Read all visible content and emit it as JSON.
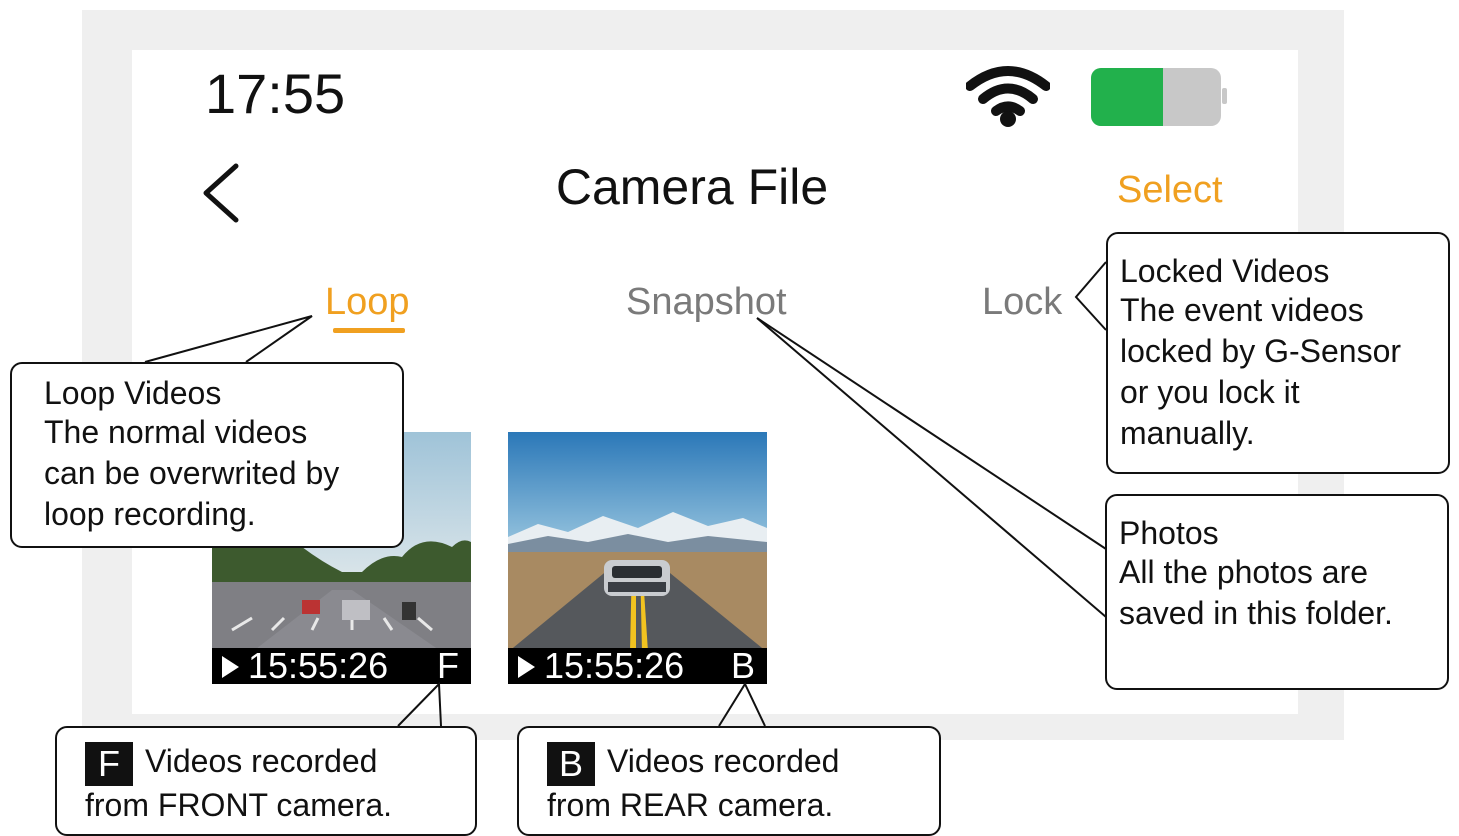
{
  "status": {
    "time": "17:55"
  },
  "header": {
    "title": "Camera File",
    "select_label": "Select"
  },
  "tabs": {
    "loop": "Loop",
    "snapshot": "Snapshot",
    "lock": "Lock"
  },
  "thumbnails": [
    {
      "timestamp": "15:55:26",
      "camera": "F"
    },
    {
      "timestamp": "15:55:26",
      "camera": "B"
    }
  ],
  "callouts": {
    "loop": {
      "title": "Loop Videos",
      "lines": [
        "The normal videos",
        "can be overwrited by",
        "loop recording."
      ]
    },
    "lock": {
      "title": "Locked Videos",
      "lines": [
        "The event videos",
        "locked by G-Sensor",
        "or you lock it",
        "manually."
      ]
    },
    "photos": {
      "title": "Photos",
      "lines": [
        "All the photos are",
        "saved in this folder."
      ]
    },
    "front": {
      "badge": "F",
      "line1": "Videos recorded",
      "line2": "from FRONT camera."
    },
    "rear": {
      "badge": "B",
      "line1": "Videos recorded",
      "line2": "from REAR camera."
    }
  },
  "colors": {
    "accent": "#f0a020",
    "inactive_tab": "#7a7a7a",
    "battery_charge": "#22b14c",
    "battery_empty": "#c8c8c8"
  },
  "icons": {
    "status": [
      "wifi-icon",
      "battery-icon"
    ],
    "nav": "back-chevron-icon",
    "playback": "play-icon"
  },
  "battery": {
    "level": 0.5
  }
}
